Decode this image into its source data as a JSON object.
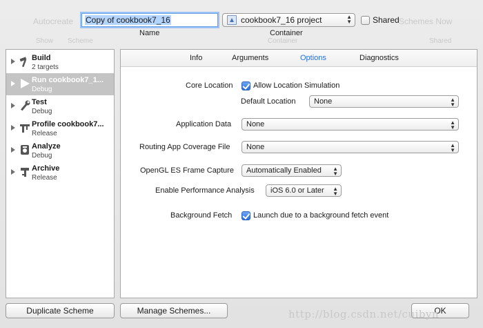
{
  "background": {
    "autocreate": "Autocreate",
    "show": "Show",
    "scheme": "Scheme",
    "container": "Container",
    "shared": "Shared",
    "schemes_now": "Schemes Now"
  },
  "top": {
    "name_value": "Copy of cookbook7_16",
    "name_caption": "Name",
    "container_value": "cookbook7_16 project",
    "container_caption": "Container",
    "shared_label": "Shared",
    "shared_checked": false
  },
  "actions": [
    {
      "title": "Build",
      "sub": "2 targets",
      "icon": "hammer-icon"
    },
    {
      "title": "Run cookbook7_1...",
      "sub": "Debug",
      "icon": "play-icon",
      "selected": true
    },
    {
      "title": "Test",
      "sub": "Debug",
      "icon": "wrench-icon"
    },
    {
      "title": "Profile cookbook7...",
      "sub": "Release",
      "icon": "caliper-icon"
    },
    {
      "title": "Analyze",
      "sub": "Debug",
      "icon": "analyze-icon"
    },
    {
      "title": "Archive",
      "sub": "Release",
      "icon": "archive-icon"
    }
  ],
  "tabs": [
    "Info",
    "Arguments",
    "Options",
    "Diagnostics"
  ],
  "active_tab": "Options",
  "options": {
    "core_location_label": "Core Location",
    "allow_location_label": "Allow Location Simulation",
    "allow_location_checked": true,
    "default_location_label": "Default Location",
    "default_location_value": "None",
    "application_data_label": "Application Data",
    "application_data_value": "None",
    "routing_label": "Routing App Coverage File",
    "routing_value": "None",
    "opengl_label": "OpenGL ES Frame Capture",
    "opengl_value": "Automatically Enabled",
    "perf_label": "Enable Performance Analysis",
    "perf_value": "iOS 6.0 or Later",
    "bg_fetch_label": "Background Fetch",
    "bg_fetch_option": "Launch due to a background fetch event",
    "bg_fetch_checked": true
  },
  "buttons": {
    "duplicate": "Duplicate Scheme",
    "manage": "Manage Schemes...",
    "ok": "OK"
  },
  "watermark": "http://blog.csdn.net/cuibyn",
  "colors": {
    "accent": "#2a6fd6",
    "selection": "#c4c4c4"
  }
}
